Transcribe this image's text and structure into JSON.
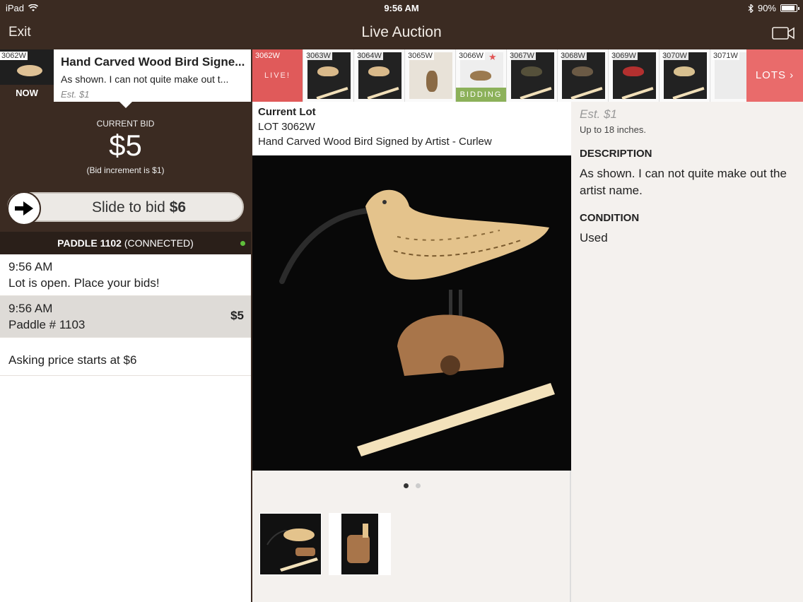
{
  "status_bar": {
    "device": "iPad",
    "time": "9:56 AM",
    "battery": "90%"
  },
  "nav": {
    "exit": "Exit",
    "title": "Live Auction"
  },
  "strip": {
    "lots_button": "LOTS",
    "live_label": "LIVE!",
    "bidding_label": "BIDDING",
    "thumbs": [
      "3062W",
      "3063W",
      "3064W",
      "3065W",
      "3066W",
      "3067W",
      "3068W",
      "3069W",
      "3070W",
      "3071W"
    ]
  },
  "now_card": {
    "lot": "3062W",
    "badge": "NOW",
    "title": "Hand Carved Wood Bird Signe...",
    "desc": "As shown. I can not quite make out t...",
    "est": "Est. $1"
  },
  "bid": {
    "label": "CURRENT BID",
    "amount": "$5",
    "increment": "(Bid increment is $1)",
    "slide_text": "Slide to bid",
    "slide_amount": "$6"
  },
  "paddle": {
    "number": "PADDLE 1102",
    "status": "(CONNECTED)"
  },
  "feed": [
    {
      "time": "9:56 AM",
      "text": "Lot is open. Place your bids!"
    },
    {
      "time": "9:56 AM",
      "text": "Paddle # 1103",
      "amount": "$5"
    }
  ],
  "asking": "Asking price starts at $6",
  "lot_detail": {
    "heading": "Current Lot",
    "lot_number": "LOT 3062W",
    "title": "Hand Carved Wood Bird Signed by Artist - Curlew"
  },
  "right": {
    "est": "Est. $1",
    "size": "Up to 18 inches.",
    "desc_heading": "DESCRIPTION",
    "desc": "As shown. I can not quite make out the artist name.",
    "cond_heading": "CONDITION",
    "cond": "Used"
  },
  "colors": {
    "brown": "#3b2b22",
    "live_red": "#e05a5a",
    "bidding_green": "#8cb15a",
    "connected": "#5fbf3b"
  },
  "icons": [
    "wifi-icon",
    "bluetooth-icon",
    "battery-icon",
    "video-camera-icon",
    "arrow-right-icon",
    "star-icon",
    "chevron-right-icon"
  ]
}
